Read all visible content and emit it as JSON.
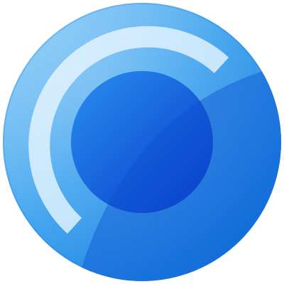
{
  "icon": {
    "name": "circular-logo-icon",
    "colors": {
      "outer_light": "#8fd0f7",
      "outer_mid": "#3aa0ee",
      "outer_dark": "#0a6fd9",
      "inner_light": "#2a8fee",
      "inner_dark": "#0637cc",
      "ring": "#e9f6ff",
      "gloss": "#ffffff"
    }
  }
}
